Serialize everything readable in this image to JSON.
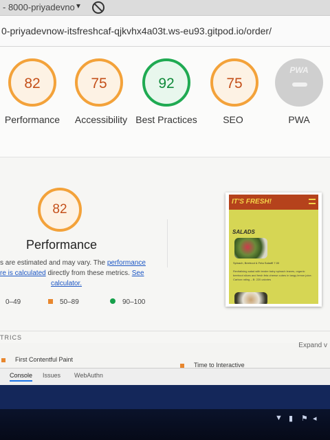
{
  "browser": {
    "tab_title": "- 8000-priyadevno",
    "url": "0-priyadevnow-itsfreshcaf-qjkvhx4a03t.ws-eu93.gitpod.io/order/"
  },
  "scores": [
    {
      "label": "Performance",
      "score": "82",
      "status": "orange"
    },
    {
      "label": "Accessibility",
      "score": "75",
      "status": "orange"
    },
    {
      "label": "Best Practices",
      "score": "92",
      "status": "green"
    },
    {
      "label": "SEO",
      "score": "75",
      "status": "orange"
    },
    {
      "label": "PWA",
      "score": "",
      "status": "gray",
      "badge": "PWA"
    }
  ],
  "performance": {
    "score": "82",
    "title": "Performance",
    "desc_line1": "s are estimated and may vary. The ",
    "desc_link1": "performance",
    "desc_link2": "re is calculated",
    "desc_line2": " directly from these metrics. ",
    "desc_link3": "See",
    "desc_link4": "calculator."
  },
  "legend": [
    {
      "range": "0–49",
      "color": "#e8453c",
      "shape": "triangle"
    },
    {
      "range": "50–89",
      "color": "#e8872e",
      "shape": "square"
    },
    {
      "range": "90–100",
      "color": "#16a04a",
      "shape": "circle"
    }
  ],
  "screenshot": {
    "brand": "IT'S FRESH!",
    "section": "SALADS",
    "item": "Spinach, Beetroot & Feta Salad€ 7.00",
    "description": "Revitalising salad with tender baby spinach leaves, organic beetroot slices and fresh feta cheese cubes in tangy lemon juice. Carbon rating – B: 220 calories"
  },
  "metrics": {
    "heading": "TRICS",
    "expand": "Expand v",
    "items": [
      "First Contentful Paint",
      "Time to Interactive"
    ]
  },
  "devtools": {
    "tabs": [
      "Console",
      "Issues",
      "WebAuthn"
    ]
  },
  "colors": {
    "orange": "#f3a23a",
    "green": "#1faa52",
    "gray": "#cfcfcf"
  }
}
